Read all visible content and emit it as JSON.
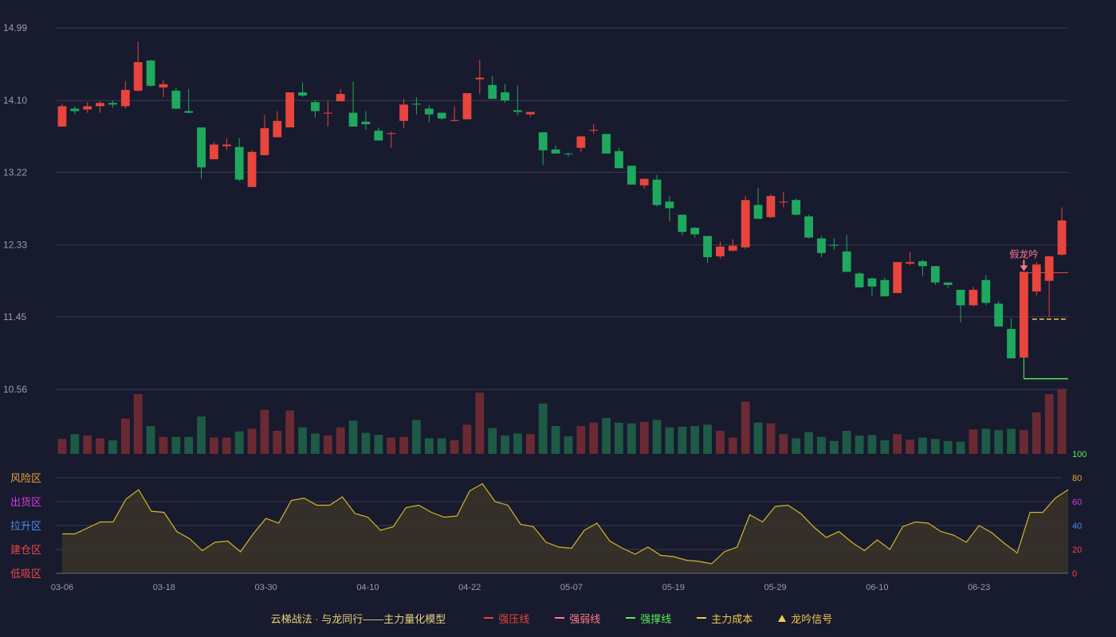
{
  "colors": {
    "background": "#181a2e",
    "up": "#e8453c",
    "down": "#1fa95e",
    "vol_up": "#6a2a34",
    "vol_down": "#1e5a45",
    "grid": "#3a3d52",
    "axis_text": "#9a9cae",
    "osc_line": "#d4b62a",
    "osc_fill": "#3a3428"
  },
  "chart_data": [
    {
      "type": "candlestick",
      "y_ticks": [
        "14.99",
        "14.10",
        "13.22",
        "12.33",
        "11.45",
        "10.56"
      ],
      "ylim": [
        10.56,
        14.99
      ],
      "x_ticks": [
        "03-06",
        "03-18",
        "03-30",
        "04-10",
        "04-22",
        "05-07",
        "05-19",
        "05-29",
        "06-10",
        "06-23"
      ],
      "x_tick_index": [
        0,
        8,
        16,
        24,
        32,
        40,
        48,
        56,
        64,
        72
      ],
      "ohlc": [
        [
          13.78,
          14.03,
          13.78,
          14.06
        ],
        [
          14.0,
          13.97,
          13.93,
          14.03
        ],
        [
          13.99,
          14.03,
          13.95,
          14.08
        ],
        [
          14.03,
          14.07,
          13.95,
          14.09
        ],
        [
          14.07,
          14.05,
          14.01,
          14.1
        ],
        [
          14.03,
          14.23,
          14.0,
          14.34
        ],
        [
          14.22,
          14.57,
          14.21,
          14.82
        ],
        [
          14.59,
          14.28,
          14.27,
          14.6
        ],
        [
          14.26,
          14.3,
          14.14,
          14.35
        ],
        [
          14.22,
          14.0,
          13.99,
          14.26
        ],
        [
          13.97,
          13.95,
          13.94,
          14.24
        ],
        [
          13.77,
          13.28,
          13.14,
          13.77
        ],
        [
          13.38,
          13.56,
          13.38,
          13.59
        ],
        [
          13.54,
          13.56,
          13.49,
          13.64
        ],
        [
          13.53,
          13.13,
          13.11,
          13.64
        ],
        [
          13.04,
          13.47,
          13.04,
          13.49
        ],
        [
          13.43,
          13.76,
          13.43,
          13.92
        ],
        [
          13.65,
          13.85,
          13.65,
          13.97
        ],
        [
          13.77,
          14.2,
          13.77,
          14.2
        ],
        [
          14.2,
          14.16,
          14.14,
          14.32
        ],
        [
          14.08,
          13.97,
          13.89,
          14.1
        ],
        [
          13.94,
          13.95,
          13.78,
          14.1
        ],
        [
          14.09,
          14.18,
          14.09,
          14.24
        ],
        [
          13.95,
          13.78,
          13.78,
          14.33
        ],
        [
          13.84,
          13.81,
          13.74,
          13.97
        ],
        [
          13.73,
          13.61,
          13.61,
          13.77
        ],
        [
          13.69,
          13.7,
          13.52,
          13.72
        ],
        [
          13.85,
          14.05,
          13.76,
          14.12
        ],
        [
          14.06,
          14.05,
          13.93,
          14.14
        ],
        [
          14.0,
          13.93,
          13.83,
          14.04
        ],
        [
          13.95,
          13.88,
          13.86,
          13.92
        ],
        [
          13.85,
          13.86,
          13.84,
          14.03
        ],
        [
          13.87,
          14.19,
          13.87,
          14.19
        ],
        [
          14.36,
          14.38,
          14.18,
          14.6
        ],
        [
          14.29,
          14.12,
          14.12,
          14.4
        ],
        [
          14.2,
          14.1,
          14.07,
          14.3
        ],
        [
          13.98,
          13.96,
          13.92,
          14.28
        ],
        [
          13.93,
          13.96,
          13.9,
          13.96
        ],
        [
          13.71,
          13.49,
          13.31,
          13.71
        ],
        [
          13.5,
          13.45,
          13.45,
          13.55
        ],
        [
          13.45,
          13.44,
          13.41,
          13.46
        ],
        [
          13.52,
          13.66,
          13.47,
          13.66
        ],
        [
          13.74,
          13.74,
          13.69,
          13.81
        ],
        [
          13.69,
          13.45,
          13.45,
          13.69
        ],
        [
          13.48,
          13.27,
          13.27,
          13.52
        ],
        [
          13.3,
          13.07,
          13.07,
          13.3
        ],
        [
          13.06,
          13.14,
          13.02,
          13.14
        ],
        [
          13.13,
          12.82,
          12.8,
          13.19
        ],
        [
          12.86,
          12.78,
          12.62,
          12.93
        ],
        [
          12.7,
          12.49,
          12.45,
          12.7
        ],
        [
          12.54,
          12.46,
          12.42,
          12.55
        ],
        [
          12.44,
          12.18,
          12.11,
          12.44
        ],
        [
          12.19,
          12.31,
          12.16,
          12.37
        ],
        [
          12.26,
          12.32,
          12.25,
          12.4
        ],
        [
          12.3,
          12.88,
          12.28,
          12.93
        ],
        [
          12.82,
          12.65,
          12.66,
          13.03
        ],
        [
          12.67,
          12.93,
          12.66,
          12.95
        ],
        [
          12.85,
          12.86,
          12.79,
          12.98
        ],
        [
          12.88,
          12.7,
          12.69,
          12.9
        ],
        [
          12.68,
          12.42,
          12.41,
          12.7
        ],
        [
          12.41,
          12.23,
          12.18,
          12.44
        ],
        [
          12.33,
          12.32,
          12.27,
          12.41
        ],
        [
          12.25,
          12.0,
          12.0,
          12.45
        ],
        [
          11.98,
          11.81,
          11.81,
          12.0
        ],
        [
          11.92,
          11.82,
          11.71,
          11.93
        ],
        [
          11.9,
          11.7,
          11.7,
          11.93
        ],
        [
          11.74,
          12.12,
          11.74,
          12.12
        ],
        [
          12.1,
          12.12,
          12.08,
          12.24
        ],
        [
          12.13,
          12.07,
          11.95,
          12.15
        ],
        [
          12.07,
          11.87,
          11.84,
          12.07
        ],
        [
          11.87,
          11.84,
          11.8,
          11.87
        ],
        [
          11.78,
          11.59,
          11.38,
          11.78
        ],
        [
          11.59,
          11.78,
          11.58,
          11.82
        ],
        [
          11.9,
          11.62,
          11.59,
          11.96
        ],
        [
          11.61,
          11.33,
          11.33,
          11.64
        ],
        [
          11.3,
          10.94,
          10.94,
          11.43
        ],
        [
          10.95,
          12.0,
          10.95,
          12.0
        ],
        [
          11.76,
          12.09,
          11.71,
          12.12
        ],
        [
          11.89,
          12.19,
          11.45,
          12.2
        ],
        [
          12.21,
          12.63,
          12.2,
          12.79
        ]
      ],
      "annotation": {
        "label": "假龙吟",
        "index": 76
      },
      "lines": {
        "strong_pressure": {
          "from_index": 76,
          "value": 11.99
        },
        "main_cost": {
          "from_index": 77,
          "value": 11.42
        },
        "strong_support": {
          "from_index": 76,
          "value": 10.69
        }
      }
    },
    {
      "type": "bar",
      "series": "volume",
      "values": [
        22,
        29,
        27,
        23,
        20,
        52,
        88,
        41,
        25,
        25,
        25,
        55,
        24,
        24,
        33,
        37,
        65,
        34,
        64,
        39,
        30,
        27,
        39,
        49,
        31,
        28,
        24,
        25,
        50,
        23,
        23,
        20,
        43,
        90,
        38,
        27,
        30,
        29,
        74,
        41,
        26,
        41,
        46,
        53,
        46,
        45,
        47,
        50,
        39,
        40,
        41,
        43,
        34,
        24,
        77,
        46,
        45,
        29,
        23,
        32,
        25,
        19,
        34,
        27,
        28,
        20,
        29,
        21,
        24,
        22,
        19,
        18,
        36,
        37,
        35,
        37,
        35,
        61,
        88,
        95,
        95
      ],
      "ylim": [
        0,
        95
      ]
    },
    {
      "type": "area",
      "series": "oscillator",
      "y_ticks": [
        "100",
        "80",
        "60",
        "40",
        "20",
        "0"
      ],
      "ylim": [
        0,
        100
      ],
      "zones": [
        "风险区",
        "出货区",
        "拉升区",
        "建仓区",
        "低吸区"
      ],
      "zone_colors": [
        "#e8a03a",
        "#d63cd6",
        "#4a8fe8",
        "#e84a4a",
        "#e84a4a"
      ],
      "values": [
        33,
        33,
        38,
        43,
        43,
        62,
        70,
        52,
        51,
        35,
        29,
        19,
        26,
        27,
        18,
        33,
        46,
        42,
        61,
        63,
        57,
        57,
        64,
        50,
        47,
        36,
        39,
        55,
        57,
        51,
        47,
        48,
        69,
        75,
        60,
        57,
        41,
        39,
        26,
        22,
        21,
        36,
        42,
        27,
        21,
        16,
        22,
        15,
        14,
        11,
        10,
        8,
        18,
        22,
        49,
        43,
        56,
        57,
        50,
        39,
        30,
        35,
        26,
        19,
        28,
        20,
        39,
        43,
        42,
        35,
        32,
        26,
        40,
        34,
        25,
        17,
        51,
        51,
        63,
        70
      ]
    }
  ],
  "legend": {
    "title": "云梯战法 · 与龙同行——主力量化模型",
    "items": [
      {
        "label": "强压线",
        "color": "#e8453c",
        "style": "solid"
      },
      {
        "label": "强弱线",
        "color": "#ff7a8a",
        "style": "dashed"
      },
      {
        "label": "强撑线",
        "color": "#5ae85a",
        "style": "solid"
      },
      {
        "label": "主力成本",
        "color": "#f0c94a",
        "style": "dashed"
      },
      {
        "label": "龙吟信号",
        "color": "#f0c94a",
        "style": "triangle"
      }
    ]
  }
}
